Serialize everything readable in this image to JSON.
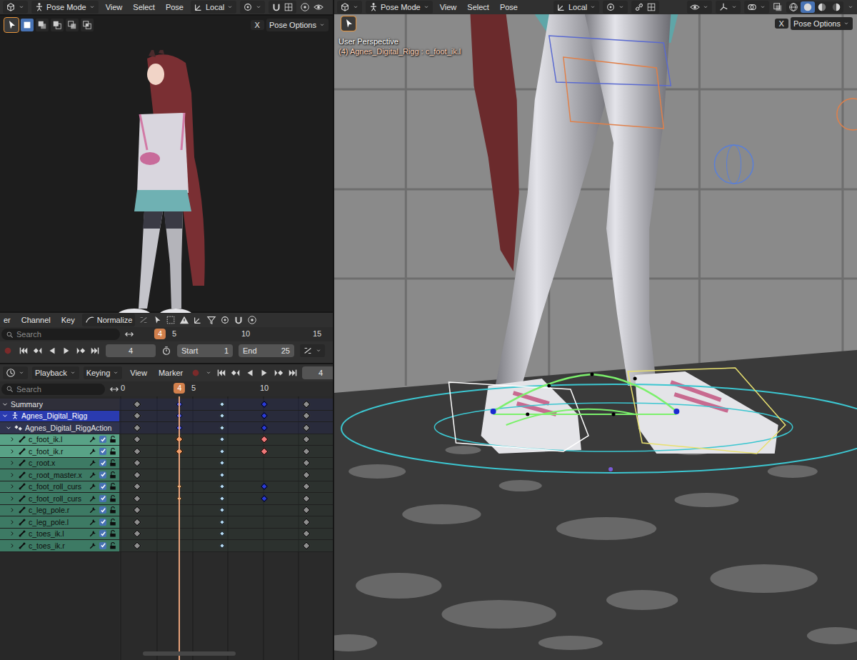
{
  "left_viewport": {
    "header": {
      "mode": "Pose Mode",
      "menus": [
        "View",
        "Select",
        "Pose"
      ],
      "orientation": "Local"
    },
    "tool_header": {
      "tool_selected": true,
      "select_modes": [
        {
          "kind": "set",
          "selected": true
        },
        {
          "kind": "extend",
          "selected": false
        },
        {
          "kind": "subtract",
          "selected": false
        },
        {
          "kind": "difference",
          "selected": false
        },
        {
          "kind": "intersect",
          "selected": false
        }
      ],
      "axis": "X",
      "options": "Pose Options"
    }
  },
  "timeline": {
    "header": {
      "menus": [
        "er",
        "Channel",
        "Key"
      ],
      "normalize": {
        "label": "Normalize",
        "on": false
      }
    },
    "search": {
      "placeholder": "Search"
    },
    "ruler": [
      "5",
      "10",
      "15"
    ],
    "current_frame": "4",
    "controls": {
      "autokey": false,
      "frame": "4",
      "start_label": "Start",
      "start": "1",
      "end_label": "End",
      "end": "25"
    }
  },
  "dopesheet": {
    "header": {
      "menus": [
        "Playback",
        "Keying",
        "View",
        "Marker"
      ],
      "autokey": false,
      "frame": "4"
    },
    "search": {
      "placeholder": "Search"
    },
    "ruler": [
      "0",
      "5",
      "10"
    ],
    "current_frame": "4",
    "channels": [
      {
        "name": "Summary",
        "kind": "summary",
        "expanded": true,
        "selected": false,
        "keys": [
          {
            "frame": 1,
            "kind": "keyframe",
            "selected": false
          },
          {
            "frame": 4,
            "kind": "moving-hold",
            "selected": true
          },
          {
            "frame": 7,
            "kind": "breakdown",
            "selected": false
          },
          {
            "frame": 10,
            "kind": "moving-hold",
            "selected": false
          },
          {
            "frame": 13,
            "kind": "keyframe",
            "selected": false
          }
        ]
      },
      {
        "name": "Agnes_Digital_Rigg",
        "kind": "object",
        "expanded": true,
        "selected": true,
        "keys": [
          {
            "frame": 1,
            "kind": "keyframe",
            "selected": false
          },
          {
            "frame": 4,
            "kind": "moving-hold",
            "selected": true
          },
          {
            "frame": 7,
            "kind": "breakdown",
            "selected": false
          },
          {
            "frame": 10,
            "kind": "moving-hold",
            "selected": false
          },
          {
            "frame": 13,
            "kind": "keyframe",
            "selected": false
          }
        ]
      },
      {
        "name": "Agnes_Digital_RiggAction",
        "kind": "action",
        "expanded": true,
        "selected": false,
        "keys": [
          {
            "frame": 1,
            "kind": "keyframe",
            "selected": false
          },
          {
            "frame": 4,
            "kind": "moving-hold",
            "selected": true
          },
          {
            "frame": 7,
            "kind": "breakdown",
            "selected": false
          },
          {
            "frame": 10,
            "kind": "moving-hold",
            "selected": false
          },
          {
            "frame": 13,
            "kind": "keyframe",
            "selected": false
          }
        ]
      },
      {
        "name": "c_foot_ik.l",
        "kind": "group",
        "expanded": false,
        "selected": true,
        "enabled": true,
        "locked": false,
        "keys": [
          {
            "frame": 1,
            "kind": "keyframe",
            "selected": false
          },
          {
            "frame": 4,
            "kind": "keyframe",
            "selected": true
          },
          {
            "frame": 7,
            "kind": "breakdown",
            "selected": false
          },
          {
            "frame": 10,
            "kind": "extreme",
            "selected": true
          },
          {
            "frame": 13,
            "kind": "keyframe",
            "selected": false
          }
        ]
      },
      {
        "name": "c_foot_ik.r",
        "kind": "group",
        "expanded": false,
        "selected": true,
        "enabled": true,
        "locked": false,
        "keys": [
          {
            "frame": 1,
            "kind": "keyframe",
            "selected": false
          },
          {
            "frame": 4,
            "kind": "keyframe",
            "selected": true
          },
          {
            "frame": 7,
            "kind": "breakdown",
            "selected": false
          },
          {
            "frame": 10,
            "kind": "extreme",
            "selected": true
          },
          {
            "frame": 13,
            "kind": "keyframe",
            "selected": false
          }
        ]
      },
      {
        "name": "c_root.x",
        "kind": "group",
        "expanded": false,
        "selected": false,
        "enabled": true,
        "locked": false,
        "keys": [
          {
            "frame": 1,
            "kind": "keyframe",
            "selected": false
          },
          {
            "frame": 7,
            "kind": "breakdown",
            "selected": false
          },
          {
            "frame": 13,
            "kind": "keyframe",
            "selected": false
          }
        ]
      },
      {
        "name": "c_root_master.x",
        "kind": "group",
        "expanded": false,
        "selected": false,
        "enabled": true,
        "locked": false,
        "keys": [
          {
            "frame": 1,
            "kind": "keyframe",
            "selected": false
          },
          {
            "frame": 7,
            "kind": "breakdown",
            "selected": false
          },
          {
            "frame": 13,
            "kind": "keyframe",
            "selected": false
          }
        ]
      },
      {
        "name": "c_foot_roll_curs",
        "kind": "group",
        "expanded": false,
        "selected": false,
        "enabled": true,
        "locked": false,
        "keys": [
          {
            "frame": 1,
            "kind": "keyframe",
            "selected": false
          },
          {
            "frame": 4,
            "kind": "breakdown",
            "selected": true
          },
          {
            "frame": 7,
            "kind": "breakdown",
            "selected": false
          },
          {
            "frame": 10,
            "kind": "moving-hold",
            "selected": false
          },
          {
            "frame": 13,
            "kind": "keyframe",
            "selected": false
          }
        ]
      },
      {
        "name": "c_foot_roll_curs",
        "kind": "group",
        "expanded": false,
        "selected": false,
        "enabled": true,
        "locked": false,
        "keys": [
          {
            "frame": 1,
            "kind": "keyframe",
            "selected": false
          },
          {
            "frame": 4,
            "kind": "breakdown",
            "selected": true
          },
          {
            "frame": 7,
            "kind": "breakdown",
            "selected": false
          },
          {
            "frame": 10,
            "kind": "moving-hold",
            "selected": false
          },
          {
            "frame": 13,
            "kind": "keyframe",
            "selected": false
          }
        ]
      },
      {
        "name": "c_leg_pole.r",
        "kind": "group",
        "expanded": false,
        "selected": false,
        "enabled": true,
        "locked": false,
        "keys": [
          {
            "frame": 1,
            "kind": "keyframe",
            "selected": false
          },
          {
            "frame": 7,
            "kind": "breakdown",
            "selected": false
          },
          {
            "frame": 13,
            "kind": "keyframe",
            "selected": false
          }
        ]
      },
      {
        "name": "c_leg_pole.l",
        "kind": "group",
        "expanded": false,
        "selected": false,
        "enabled": true,
        "locked": false,
        "keys": [
          {
            "frame": 1,
            "kind": "keyframe",
            "selected": false
          },
          {
            "frame": 7,
            "kind": "breakdown",
            "selected": false
          },
          {
            "frame": 13,
            "kind": "keyframe",
            "selected": false
          }
        ]
      },
      {
        "name": "c_toes_ik.l",
        "kind": "group",
        "expanded": false,
        "selected": false,
        "enabled": true,
        "locked": false,
        "keys": [
          {
            "frame": 1,
            "kind": "keyframe",
            "selected": false
          },
          {
            "frame": 7,
            "kind": "breakdown",
            "selected": false
          },
          {
            "frame": 13,
            "kind": "keyframe",
            "selected": false
          }
        ]
      },
      {
        "name": "c_toes_ik.r",
        "kind": "group",
        "expanded": false,
        "selected": false,
        "enabled": true,
        "locked": false,
        "keys": [
          {
            "frame": 1,
            "kind": "keyframe",
            "selected": false
          },
          {
            "frame": 7,
            "kind": "breakdown",
            "selected": false
          },
          {
            "frame": 13,
            "kind": "keyframe",
            "selected": false
          }
        ]
      }
    ]
  },
  "viewport": {
    "header": {
      "mode": "Pose Mode",
      "menus": [
        "View",
        "Select",
        "Pose"
      ],
      "orientation": "Local",
      "shading": [
        {
          "kind": "wireframe",
          "selected": false
        },
        {
          "kind": "solid",
          "selected": true
        },
        {
          "kind": "material",
          "selected": false
        },
        {
          "kind": "rendered",
          "selected": false
        }
      ]
    },
    "tool_header": {
      "tool_selected": true,
      "axis": "X",
      "options": "Pose Options"
    },
    "overlay": {
      "perspective": "User Perspective",
      "object": "(4) Agnes_Digital_Rigg : c_foot_ik.l"
    }
  }
}
